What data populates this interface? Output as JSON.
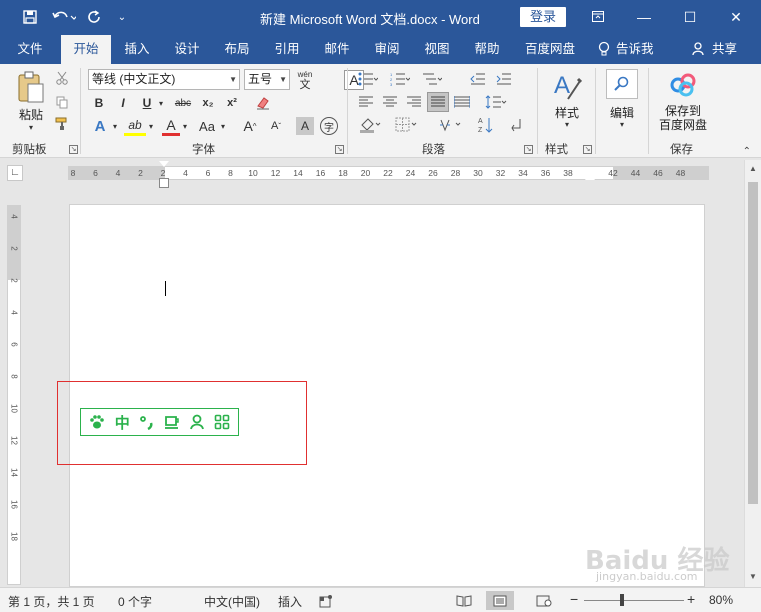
{
  "titlebar": {
    "title": "新建 Microsoft Word 文档.docx  -  Word",
    "login": "登录",
    "save_icon": "save-icon",
    "undo_icon": "undo-icon",
    "redo_icon": "redo-icon",
    "customize_icon": "customize-qat-icon"
  },
  "tabs": [
    "文件",
    "开始",
    "插入",
    "设计",
    "布局",
    "引用",
    "邮件",
    "审阅",
    "视图",
    "帮助",
    "百度网盘"
  ],
  "active_tab": "开始",
  "tell_me": "告诉我",
  "share": "共享",
  "ribbon": {
    "clipboard": {
      "label": "剪贴板",
      "paste": "粘贴"
    },
    "font": {
      "label": "字体",
      "font_name": "等线 (中文正文)",
      "font_size": "五号",
      "wen_label": "wén\n文",
      "bold": "B",
      "italic": "I",
      "underline": "U",
      "strike": "abc",
      "subscript": "x₂",
      "superscript": "x²",
      "text_effects": "A",
      "highlight": "ab",
      "font_color": "A",
      "change_case": "Aa",
      "grow": "A",
      "shrink": "A",
      "char_shading": "A",
      "enclose": "字"
    },
    "paragraph": {
      "label": "段落"
    },
    "styles": {
      "label": "样式",
      "button": "样式"
    },
    "editing": {
      "button": "编辑"
    },
    "save": {
      "label": "保存",
      "button_line1": "保存到",
      "button_line2": "百度网盘"
    }
  },
  "ruler": {
    "horizontal": [
      "8",
      "6",
      "4",
      "2",
      "2",
      "4",
      "6",
      "8",
      "10",
      "12",
      "14",
      "16",
      "18",
      "20",
      "22",
      "24",
      "26",
      "28",
      "30",
      "32",
      "34",
      "36",
      "38",
      "42",
      "44",
      "46",
      "48"
    ],
    "vertical": [
      "4",
      "2",
      "2",
      "4",
      "6",
      "8",
      "10",
      "12",
      "14",
      "16",
      "18"
    ]
  },
  "ime_toolbar": {
    "items": [
      "paw-icon",
      "中",
      "punct-icon",
      "cup-icon",
      "user-icon",
      "grid-icon"
    ],
    "mode_label": "中",
    "accent": "#2bb24c"
  },
  "statusbar": {
    "page": "第 1 页，共 1 页",
    "words": "0 个字",
    "language": "中文(中国)",
    "insert_mode": "插入",
    "zoom": "80%",
    "zoom_minus": "−",
    "zoom_plus": "+"
  },
  "watermark": {
    "text": "Baidu 经验",
    "sub": "jingyan.baidu.com"
  },
  "colors": {
    "brand": "#2b579a",
    "highlight_box": "#e03030"
  }
}
